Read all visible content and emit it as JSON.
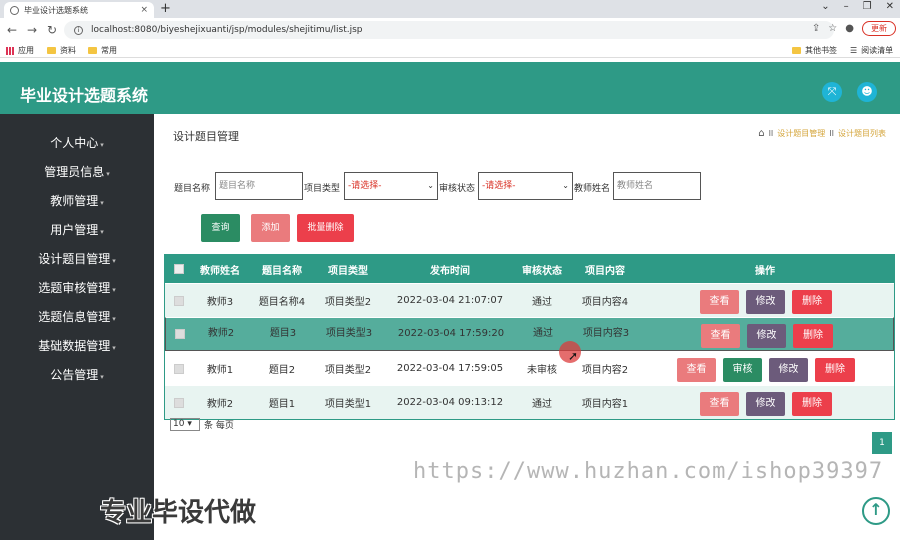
{
  "browser": {
    "tab_title": "毕业设计选题系统",
    "tab_close": "×",
    "new_tab": "+",
    "url": "localhost:8080/biyeshejixuanti/jsp/modules/shejitimu/list.jsp",
    "update_label": "更新",
    "bookmarks": [
      "应用",
      "资料",
      "常用"
    ],
    "other_bookmarks": "其他书签",
    "reading_list": "阅读清单"
  },
  "header": {
    "title": "毕业设计选题系统"
  },
  "sidebar": {
    "items": [
      {
        "label": "个人中心"
      },
      {
        "label": "管理员信息"
      },
      {
        "label": "教师管理"
      },
      {
        "label": "用户管理"
      },
      {
        "label": "设计题目管理"
      },
      {
        "label": "选题审核管理"
      },
      {
        "label": "选题信息管理"
      },
      {
        "label": "基础数据管理"
      },
      {
        "label": "公告管理"
      }
    ]
  },
  "page": {
    "title": "设计题目管理",
    "breadcrumb": [
      "设计题目管理",
      "设计题目列表"
    ],
    "breadcrumb_sep": "II"
  },
  "search": {
    "title_label": "题目名称",
    "title_placeholder": "题目名称",
    "type_label": "项目类型",
    "type_value": "-请选择-",
    "status_label": "审核状态",
    "status_value": "-请选择-",
    "teacher_label": "教师姓名",
    "teacher_placeholder": "教师姓名"
  },
  "buttons": {
    "query": "查询",
    "add": "添加",
    "batch_delete": "批量删除"
  },
  "table": {
    "headers": [
      "教师姓名",
      "题目名称",
      "项目类型",
      "发布时间",
      "审核状态",
      "项目内容",
      "操作"
    ],
    "rows": [
      {
        "teacher": "教师3",
        "title": "题目名称4",
        "type": "项目类型2",
        "time": "2022-03-04 21:07:07",
        "status": "通过",
        "content": "项目内容4"
      },
      {
        "teacher": "教师2",
        "title": "题目3",
        "type": "项目类型3",
        "time": "2022-03-04 17:59:20",
        "status": "通过",
        "content": "项目内容3"
      },
      {
        "teacher": "教师1",
        "title": "题目2",
        "type": "项目类型2",
        "time": "2022-03-04 17:59:05",
        "status": "未审核",
        "content": "项目内容2"
      },
      {
        "teacher": "教师2",
        "title": "题目1",
        "type": "项目类型1",
        "time": "2022-03-04 09:13:12",
        "status": "通过",
        "content": "项目内容1"
      }
    ],
    "actions": {
      "view": "查看",
      "edit": "修改",
      "delete": "删除",
      "audit": "审核"
    }
  },
  "pager": {
    "page_size": "10",
    "per_page_label": "条 每页",
    "current_page": "1"
  },
  "overlay": {
    "watermark": "https://www.huzhan.com/ishop39397",
    "promo": "专业毕设代做",
    "scroll_top": "↑"
  }
}
